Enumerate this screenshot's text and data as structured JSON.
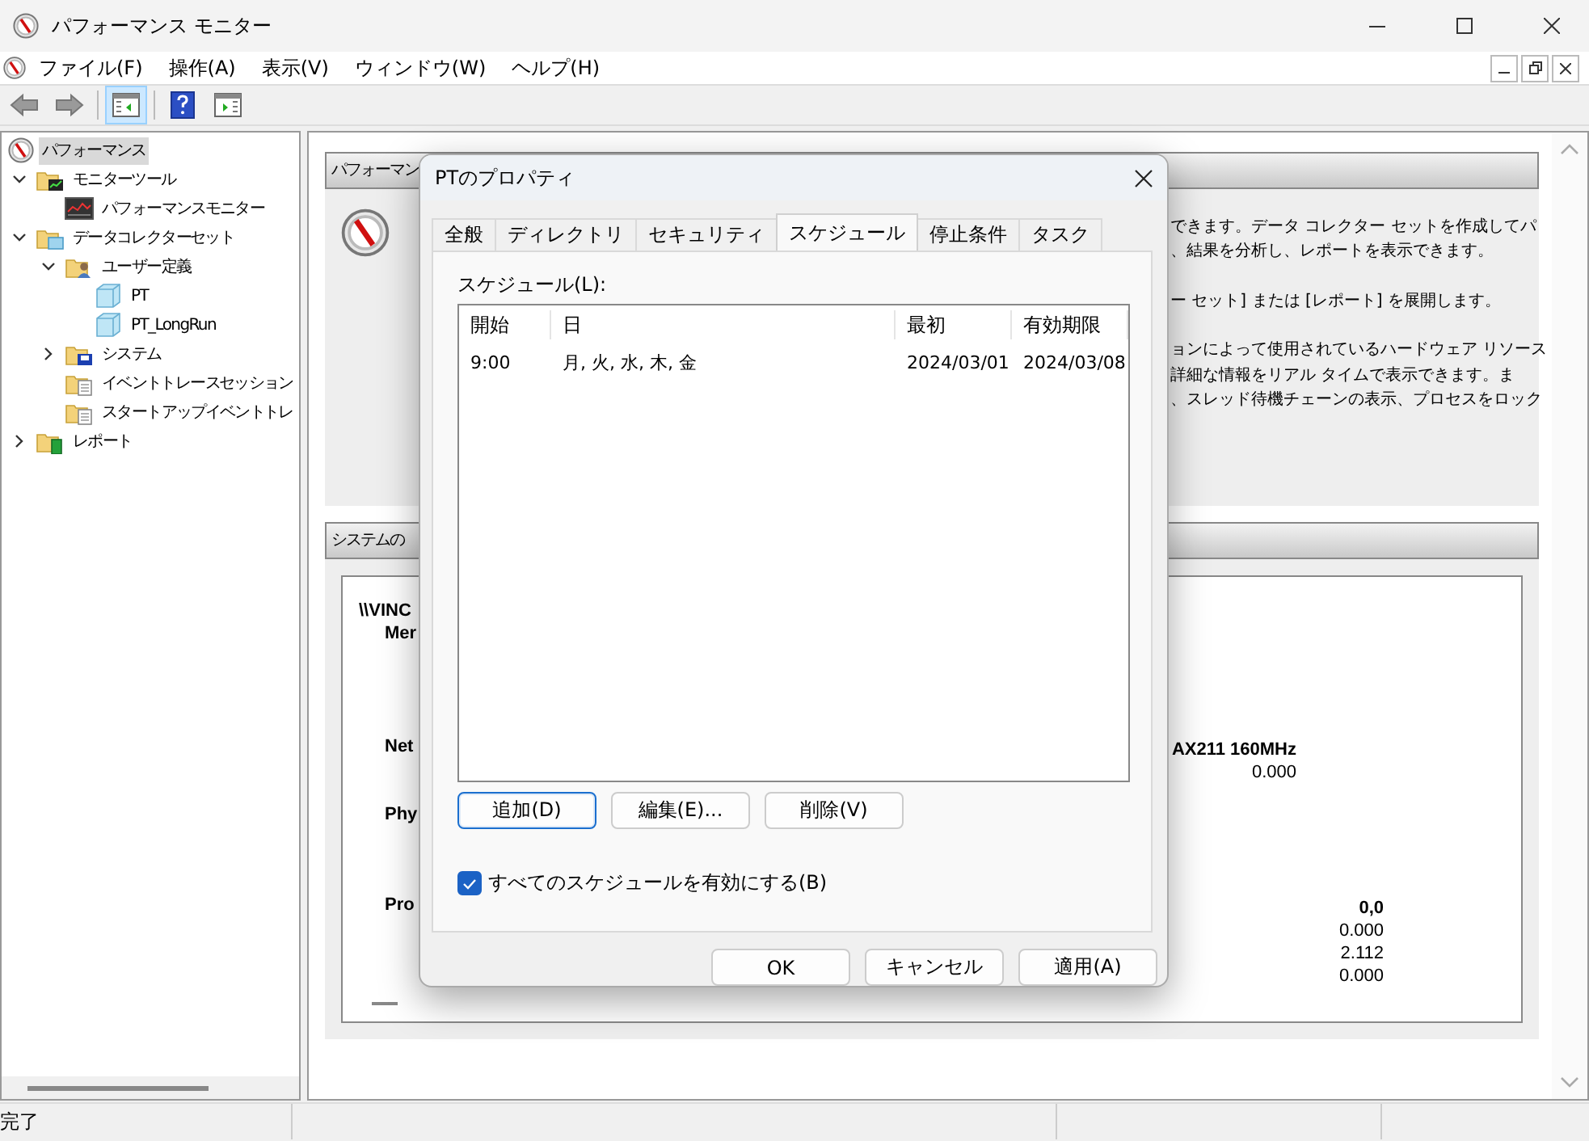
{
  "window": {
    "title": "パフォーマンス モニター"
  },
  "menu": [
    "ファイル(F)",
    "操作(A)",
    "表示(V)",
    "ウィンドウ(W)",
    "ヘルプ(H)"
  ],
  "toolbar": [
    {
      "kind": "back",
      "selected": false
    },
    {
      "kind": "forward",
      "selected": false
    },
    {
      "kind": "separator"
    },
    {
      "kind": "tree",
      "selected": true
    },
    {
      "kind": "separator"
    },
    {
      "kind": "help",
      "selected": false
    },
    {
      "kind": "pane",
      "selected": false
    }
  ],
  "tree": [
    {
      "label": "パフォーマンス",
      "kind": "gauge",
      "selected": true,
      "children": [
        {
          "label": "モニター ツール",
          "kind": "folder-chart",
          "selected": false,
          "expanded": true,
          "children": [
            {
              "label": "パフォーマンス モニター",
              "kind": "chart",
              "selected": false
            }
          ]
        },
        {
          "label": "データ コレクター セット",
          "kind": "folder-data",
          "selected": false,
          "expanded": true,
          "children": [
            {
              "label": "ユーザー定義",
              "kind": "folder-user",
              "selected": false,
              "expanded": true,
              "children": [
                {
                  "label": "PT",
                  "kind": "dataset",
                  "selected": false
                },
                {
                  "label": "PT_LongRun",
                  "kind": "dataset",
                  "selected": false
                }
              ]
            },
            {
              "label": "システム",
              "kind": "folder-system",
              "selected": false,
              "expanded": false
            },
            {
              "label": "イベント トレース セッション",
              "kind": "folder-trace",
              "selected": false
            },
            {
              "label": "スタートアップ イベント トレ",
              "kind": "folder-trace",
              "selected": false
            }
          ]
        },
        {
          "label": "レポート",
          "kind": "folder-report",
          "selected": false,
          "expanded": false
        }
      ]
    }
  ],
  "overview": {
    "header": "パフォーマン",
    "paragraphs": [
      [
        "できます。データ コレクター セットを作成してパ",
        "、結果を分析し、レポートを表示できます。"
      ],
      [
        "ー セット] または [レポート] を展開します。"
      ],
      [
        "ョンによって使用されているハードウェア リソース",
        "詳細な情報をリアル タイムで表示できます。ま",
        "、スレッド待機チェーンの表示、プロセスをロック"
      ]
    ]
  },
  "summary": {
    "header": "システムの",
    "labels": [
      "\\\\VINC",
      "Mer",
      "Net",
      "Phy",
      "Pro"
    ],
    "network": [
      {
        "text": "AX211 160MHz",
        "bold": true
      },
      {
        "text": "0.000",
        "bold": false
      }
    ],
    "processor": [
      {
        "text": "0,0",
        "bold": true
      },
      {
        "text": "0.000",
        "bold": false
      },
      {
        "text": "2.112",
        "bold": false
      },
      {
        "text": "0.000",
        "bold": false
      }
    ]
  },
  "dialog": {
    "title": "PTのプロパティ",
    "tabs": [
      {
        "label": "全般",
        "selected": false
      },
      {
        "label": "ディレクトリ",
        "selected": false
      },
      {
        "label": "セキュリティ",
        "selected": false
      },
      {
        "label": "スケジュール",
        "selected": true
      },
      {
        "label": "停止条件",
        "selected": false
      },
      {
        "label": "タスク",
        "selected": false
      }
    ],
    "list_label": "スケジュール(L):",
    "columns": [
      "開始",
      "日",
      "最初",
      "有効期限"
    ],
    "rows": [
      [
        "9:00",
        "月, 火, 水, 木, 金",
        "2024/03/01",
        "2024/03/08"
      ]
    ],
    "list_buttons": [
      {
        "label": "追加(D)",
        "focused": true
      },
      {
        "label": "編集(E)...",
        "focused": false
      },
      {
        "label": "削除(V)",
        "focused": false
      }
    ],
    "enable_all": {
      "label": "すべてのスケジュールを有効にする(B)",
      "checked": true
    },
    "buttons": [
      "OK",
      "キャンセル",
      "適用(A)"
    ]
  },
  "status_bar": {
    "text": "完了"
  }
}
